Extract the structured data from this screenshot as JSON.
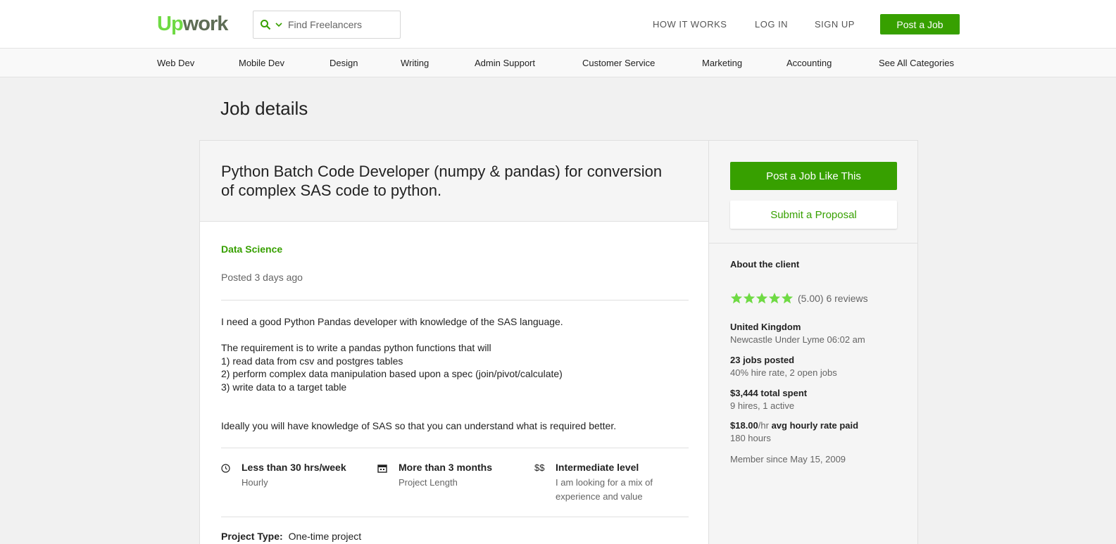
{
  "header": {
    "logo_up": "Up",
    "logo_work": "work",
    "search_placeholder": "Find Freelancers",
    "nav": [
      "HOW IT WORKS",
      "LOG IN",
      "SIGN UP"
    ],
    "post_job": "Post a Job",
    "brand_color": "#37a000"
  },
  "categories": [
    "Web Dev",
    "Mobile Dev",
    "Design",
    "Writing",
    "Admin Support",
    "Customer Service",
    "Marketing",
    "Accounting",
    "See All Categories"
  ],
  "page_title": "Job details",
  "job": {
    "title": "Python Batch Code Developer (numpy & pandas) for conversion of complex SAS code to python.",
    "category": "Data Science",
    "posted": "Posted 3 days ago",
    "description": "I need a good Python Pandas developer with knowledge of the SAS language.\n\nThe requirement is to write a pandas python functions that will\n1) read data from csv and postgres tables\n2) perform complex data manipulation based upon a spec (join/pivot/calculate)\n3) write data to a target table\n\n\nIdeally you will have knowledge of SAS so that you can understand what is required better.",
    "features": [
      {
        "icon": "clock-icon",
        "glyph": "◷",
        "title": "Less than 30 hrs/week",
        "sub": "Hourly"
      },
      {
        "icon": "calendar-icon",
        "glyph": "▦",
        "title": "More than 3 months",
        "sub": "Project Length"
      },
      {
        "icon": "dollar-icon",
        "glyph": "$$",
        "title": "Intermediate level",
        "sub": "I am looking for a mix of experience and value"
      }
    ],
    "project_type_label": "Project Type:",
    "project_type_value": "One-time project"
  },
  "sidebar": {
    "post_like": "Post a Job Like This",
    "submit": "Submit a Proposal",
    "about": "About the client",
    "rating_value": 5,
    "rating_text": "(5.00) 6 reviews",
    "country": "United Kingdom",
    "city_time": "Newcastle Under Lyme 06:02 am",
    "jobs_posted": "23 jobs posted",
    "hire_rate": "40% hire rate, 2 open jobs",
    "total_spent": "$3,444 total spent",
    "hires": "9 hires, 1 active",
    "rate_amount": "$18.00",
    "rate_unit": "/hr",
    "rate_label": "avg hourly rate paid",
    "hours": "180 hours",
    "member_since": "Member since May 15, 2009",
    "star_color": "#6fda44"
  }
}
